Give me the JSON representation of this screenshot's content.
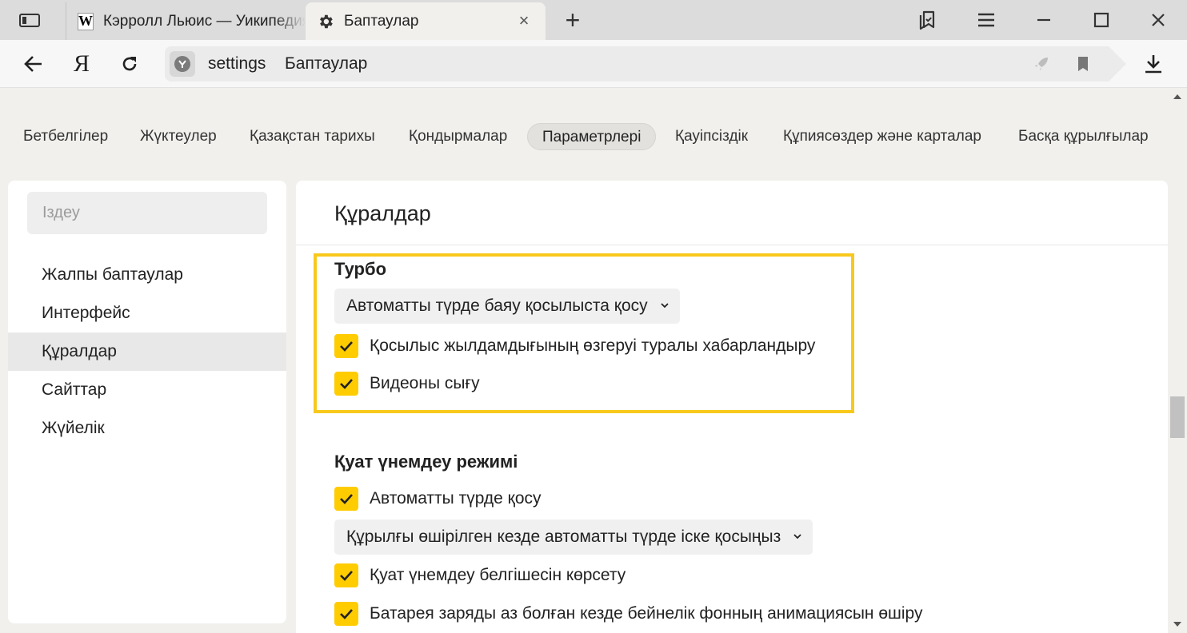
{
  "browser": {
    "tabs": [
      {
        "title": "Кэрролл Льюис — Уикипедия",
        "icon": "wikipedia-logo",
        "icon_glyph": "W"
      },
      {
        "title": "Баптаулар",
        "icon": "gear-icon"
      }
    ],
    "close_glyph": "×",
    "new_tab_glyph": "+",
    "address": {
      "scheme": "settings",
      "page": "Баптаулар"
    },
    "ya_logo": "Я"
  },
  "settings_tabs": [
    "Бетбелгілер",
    "Жүктеулер",
    "Қазақстан тарихы",
    "Қондырмалар",
    "Параметрлері",
    "Қауіпсіздік",
    "Құпиясөздер және карталар",
    "Басқа құрылғылар"
  ],
  "active_settings_tab": "Параметрлері",
  "sidebar": {
    "search_placeholder": "Іздеу",
    "items": [
      "Жалпы баптаулар",
      "Интерфейс",
      "Құралдар",
      "Сайттар",
      "Жүйелік"
    ],
    "active": "Құралдар"
  },
  "main": {
    "title": "Құралдар",
    "turbo": {
      "title": "Турбо",
      "dropdown": "Автоматты түрде баяу қосылыста қосу",
      "options": [
        {
          "label": "Қосылыс жылдамдығының өзгеруі туралы хабарландыру",
          "checked": true
        },
        {
          "label": "Видеоны сығу",
          "checked": true
        }
      ]
    },
    "power": {
      "title": "Қуат үнемдеу режимі",
      "auto": {
        "label": "Автоматты түрде қосу",
        "checked": true
      },
      "dropdown": "Құрылғы өшірілген кезде автоматты түрде іске қосыңыз",
      "options": [
        {
          "label": "Қуат үнемдеу белгішесін көрсету",
          "checked": true
        },
        {
          "label": "Батарея заряды аз болған кезде бейнелік фонның анимациясын өшіру",
          "checked": true
        }
      ]
    }
  },
  "colors": {
    "accent": "#ffcc00",
    "highlight": "#f8c91c"
  }
}
